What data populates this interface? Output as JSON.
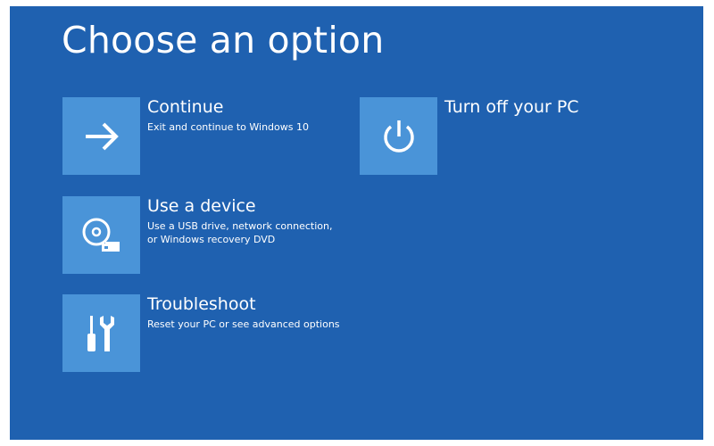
{
  "header": {
    "title": "Choose an option"
  },
  "options": {
    "continue": {
      "icon": "arrow-right-icon",
      "label": "Continue",
      "desc_lines": [
        "Exit and continue to Windows 10"
      ]
    },
    "use_device": {
      "icon": "disc-drive-icon",
      "label": "Use a device",
      "desc_lines": [
        "Use a USB drive, network connection,",
        "or Windows recovery DVD"
      ]
    },
    "troubleshoot": {
      "icon": "tools-icon",
      "label": "Troubleshoot",
      "desc_lines": [
        "Reset your PC or see advanced options"
      ]
    },
    "turn_off": {
      "icon": "power-icon",
      "label": "Turn off your PC",
      "desc_lines": []
    }
  },
  "colors": {
    "background": "#1f61b0",
    "tile": "#4a94d8",
    "text": "#ffffff"
  }
}
